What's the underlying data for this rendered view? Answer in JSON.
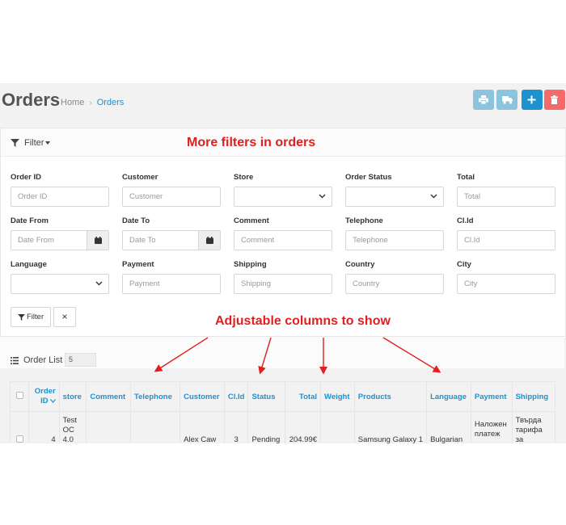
{
  "header": {
    "title": "Orders",
    "breadcrumb": [
      {
        "label": "Home"
      },
      {
        "label": "Orders"
      }
    ],
    "buttons": [
      {
        "name": "print-invoice-button",
        "icon": "print-icon",
        "color": "#8dc4dd"
      },
      {
        "name": "print-shipping-button",
        "icon": "truck-icon",
        "color": "#8dc4dd"
      },
      {
        "name": "add-order-button",
        "icon": "plus-icon",
        "color": "#1e91cf"
      },
      {
        "name": "delete-order-button",
        "icon": "trash-icon",
        "color": "#f56b6b"
      }
    ]
  },
  "filter": {
    "toggle_label": "Filter",
    "annotation": "More filters in orders",
    "fields": {
      "order_id": {
        "label": "Order ID",
        "placeholder": "Order ID"
      },
      "customer": {
        "label": "Customer",
        "placeholder": "Customer"
      },
      "store": {
        "label": "Store",
        "value": ""
      },
      "order_status": {
        "label": "Order Status",
        "value": ""
      },
      "total": {
        "label": "Total",
        "placeholder": "Total"
      },
      "date_from": {
        "label": "Date From",
        "placeholder": "Date From"
      },
      "date_to": {
        "label": "Date To",
        "placeholder": "Date To"
      },
      "comment": {
        "label": "Comment",
        "placeholder": "Comment"
      },
      "telephone": {
        "label": "Telephone",
        "placeholder": "Telephone"
      },
      "cl_id": {
        "label": "Cl.Id",
        "placeholder": "Cl.Id"
      },
      "language": {
        "label": "Language",
        "value": ""
      },
      "payment": {
        "label": "Payment",
        "placeholder": "Payment"
      },
      "shipping": {
        "label": "Shipping",
        "placeholder": "Shipping"
      },
      "country": {
        "label": "Country",
        "placeholder": "Country"
      },
      "city": {
        "label": "City",
        "placeholder": "City"
      }
    },
    "filter_button": "Filter",
    "clear_button": "×"
  },
  "order_list": {
    "title": "Order List",
    "page_size": "5",
    "annotation": "Adjustable columns to show",
    "columns": [
      "Order ID",
      "store",
      "Comment",
      "Telephone",
      "Customer",
      "Cl.Id",
      "Status",
      "Total",
      "Weight",
      "Products",
      "Language",
      "Payment",
      "Shipping"
    ],
    "rows": [
      {
        "order_id": "4",
        "store": "Test OC 4.0",
        "comment": "",
        "telephone": "",
        "customer": "Alex Caw",
        "cl_id": "3",
        "status": "Pending",
        "total": "204.99€",
        "weight": "",
        "products": "Samsung Galaxy 1",
        "language": "Bulgarian",
        "payment": "Наложен платеж",
        "shipping": "Твърда тарифа за доставка"
      }
    ]
  },
  "colors": {
    "accent": "#1e91cf",
    "annotation": "#e02020",
    "danger": "#f56b6b",
    "muted_info": "#8dc4dd"
  }
}
